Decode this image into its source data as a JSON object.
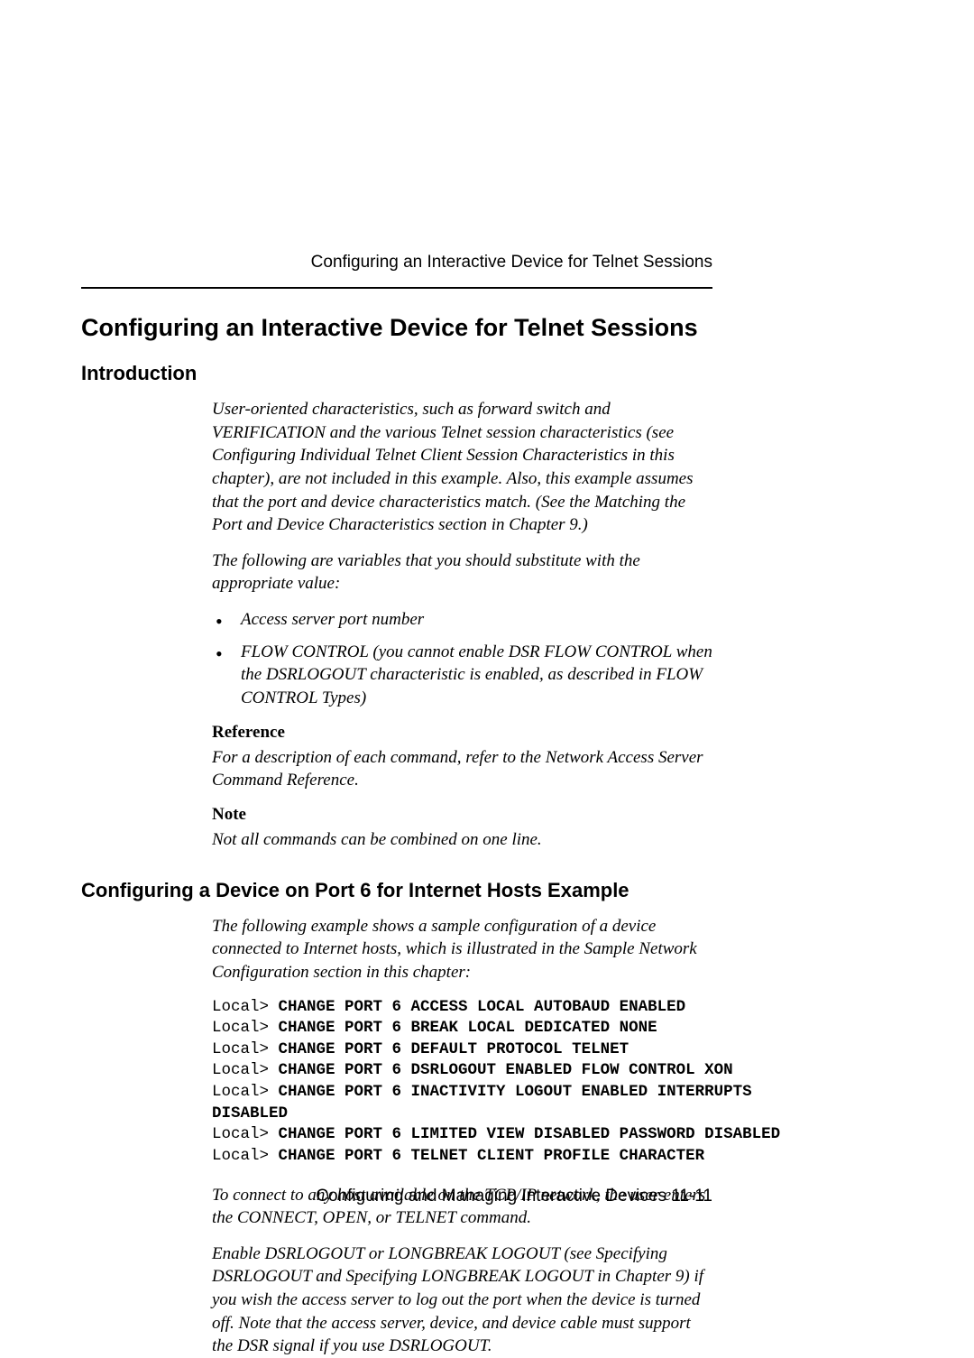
{
  "runningHeader": "Configuring an Interactive Device for Telnet Sessions",
  "sectionTitle": "Configuring an Interactive Device for Telnet Sessions",
  "intro": {
    "heading": "Introduction",
    "para1": "User-oriented characteristics, such as forward switch and VERIFICATION and the various Telnet session characteristics (see Configuring Individual Telnet Client Session Characteristics in this chapter), are not included in this example. Also, this example assumes that the port and device characteristics match. (See the Matching the Port and Device Characteristics section in Chapter 9.)",
    "para2": "The following are variables that you should substitute with the appropriate value:",
    "bullets": [
      "Access server port number",
      "FLOW CONTROL (you cannot enable DSR FLOW CONTROL when the DSRLOGOUT characteristic is enabled, as described in FLOW CONTROL Types)"
    ],
    "referenceLabel": "Reference",
    "referenceText": "For a description of each command, refer to the Network Access Server Command Reference.",
    "noteLabel": "Note",
    "noteText": "Not all commands can be combined on one line."
  },
  "example": {
    "heading": "Configuring a Device on Port 6 for Internet Hosts Example",
    "intro": "The following example shows a sample configuration of a device connected to Internet hosts, which is illustrated in the Sample Network Configuration section in this chapter:",
    "code": [
      {
        "prompt": "Local> ",
        "cmd": "CHANGE PORT 6 ACCESS LOCAL AUTOBAUD ENABLED"
      },
      {
        "prompt": "Local> ",
        "cmd": "CHANGE PORT 6 BREAK LOCAL DEDICATED NONE"
      },
      {
        "prompt": "Local> ",
        "cmd": "CHANGE PORT 6 DEFAULT PROTOCOL TELNET"
      },
      {
        "prompt": "Local> ",
        "cmd": "CHANGE PORT 6 DSRLOGOUT ENABLED FLOW CONTROL XON"
      },
      {
        "prompt": "Local> ",
        "cmd": "CHANGE PORT 6 INACTIVITY LOGOUT ENABLED INTERRUPTS"
      },
      {
        "prompt": "",
        "cmd": "DISABLED"
      },
      {
        "prompt": "Local> ",
        "cmd": "CHANGE PORT 6 LIMITED VIEW DISABLED PASSWORD DISABLED"
      },
      {
        "prompt": "Local> ",
        "cmd": "CHANGE PORT 6 TELNET CLIENT PROFILE CHARACTER"
      }
    ],
    "afterPara1": "To connect to any host available on the TCP/IP network, the user enters the CONNECT, OPEN, or TELNET command.",
    "afterPara2": "Enable DSRLOGOUT or LONGBREAK LOGOUT (see Specifying DSRLOGOUT and Specifying LONGBREAK LOGOUT in Chapter 9) if you wish the access server to log out the port when the device is turned off. Note that the access server, device, and device cable must support the DSR signal if you use DSRLOGOUT."
  },
  "footer": "Configuring and Managing Interactive Devices 11-11"
}
